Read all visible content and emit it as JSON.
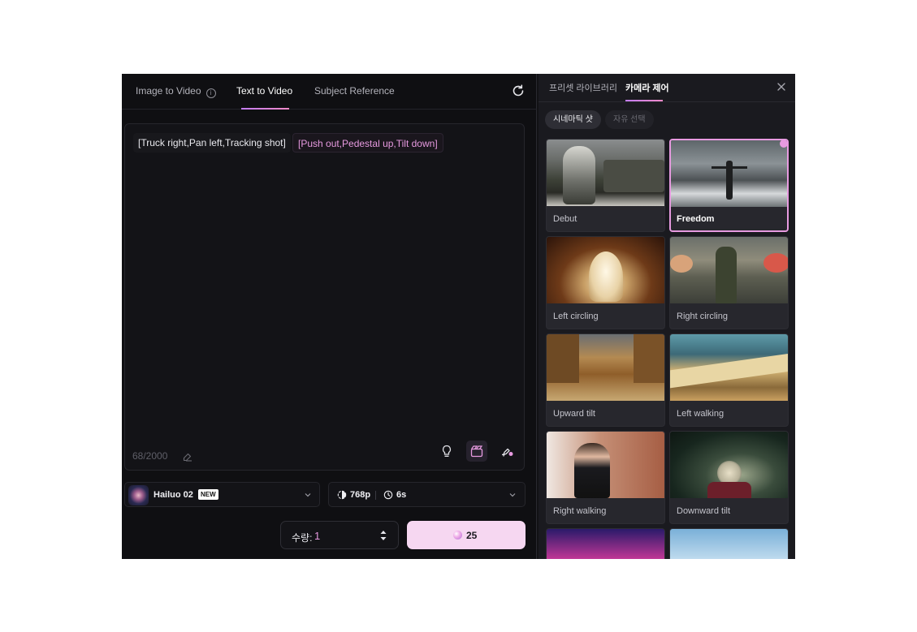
{
  "tabs": [
    {
      "label": "Image to Video"
    },
    {
      "label": "Text to Video"
    },
    {
      "label": "Subject Reference"
    }
  ],
  "active_tab": "Text to Video",
  "prompt": {
    "chip_plain": "[Truck right,Pan left,Tracking shot]",
    "chip_pink": "[Push out,Pedestal up,Tilt down]",
    "counter": "68/2000"
  },
  "model": {
    "name": "Hailuo 02",
    "badge": "NEW"
  },
  "settings": {
    "resolution": "768p",
    "duration": "6s"
  },
  "quantity": {
    "label": "수량:",
    "value": "1"
  },
  "generate": {
    "credits": "25"
  },
  "right_panel": {
    "tabs": [
      {
        "label": "프리셋 라이브러리"
      },
      {
        "label": "카메라 제어"
      }
    ],
    "active_tab": "카메라 제어",
    "filters": [
      {
        "label": "시네마틱 샷",
        "active": true
      },
      {
        "label": "자유 선택",
        "active": false
      }
    ],
    "presets": [
      {
        "label": "Debut",
        "selected": false
      },
      {
        "label": "Freedom",
        "selected": true
      },
      {
        "label": "Left circling",
        "selected": false
      },
      {
        "label": "Right circling",
        "selected": false
      },
      {
        "label": "Upward tilt",
        "selected": false
      },
      {
        "label": "Left walking",
        "selected": false
      },
      {
        "label": "Right walking",
        "selected": false
      },
      {
        "label": "Downward tilt",
        "selected": false
      }
    ]
  },
  "colors": {
    "accent_pink": "#e79ae0",
    "generate_bg": "#f6d7f1",
    "panel_bg": "#0f0f12"
  }
}
